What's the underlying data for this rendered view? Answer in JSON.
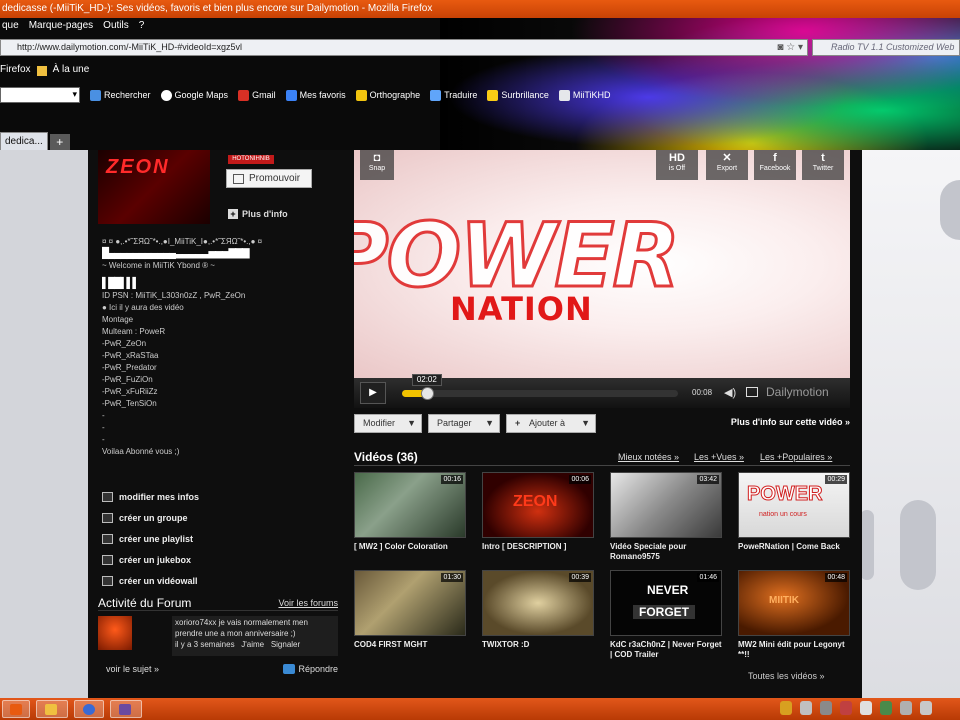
{
  "window": {
    "title": "dedicasse (-MiiTiK_HD-): Ses vidéos, favoris et bien plus encore sur Dailymotion - Mozilla Firefox"
  },
  "menu": [
    "que",
    "Marque-pages",
    "Outils",
    "?"
  ],
  "nav": {
    "url": "http://www.dailymotion.com/-MiiTiK_HD-#videoId=xgz5vl",
    "search_placeholder": "Radio TV 1.1 Customized Web"
  },
  "bookmarks_row": [
    "Firefox",
    "À la une"
  ],
  "toolbar": {
    "search_label": "Rechercher",
    "items": [
      {
        "label": "Google Maps",
        "color": "#ffffff"
      },
      {
        "label": "Gmail",
        "color": "#d93025"
      },
      {
        "label": "Mes favoris",
        "color": "#3b82f6"
      },
      {
        "label": "Orthographe",
        "color": "#f1c40f"
      },
      {
        "label": "Traduire",
        "color": "#60a5fa"
      },
      {
        "label": "Surbrillance",
        "color": "#facc15"
      },
      {
        "label": "MiiTiKHD",
        "color": "#e5e7eb"
      }
    ]
  },
  "tabs": {
    "active": "dedica...",
    "new_tab": "+"
  },
  "profile": {
    "badge": "HOTONIHNIB",
    "promote_label": "Promouvoir",
    "more_info_label": "Plus d'info",
    "bio_lines": [
      "¤ ¤ ●,.•*˜ΣЯΩ˜*•.,●I_MiiTiK_I●,.•*˜ΣЯΩ˜*•.,● ¤",
      "█▄▄▄▄▄▄▄▄▄▄▄▃▃▃▃▃▅▅▅▇▇▇",
      "~ Welcome in MiiTiK Ybond ® ~",
      "",
      "▌██▌▌▌",
      "ID PSN : MiiTiK_L303n0zZ , PwR_ZeOn",
      "● Ici il y aura des vidéo",
      "Montage",
      "Multeam : PoweR",
      "-PwR_ZeOn",
      "-PwR_xRaSTaa",
      "-PwR_Predator",
      "-PwR_FuZiOn",
      "-PwR_xFuRiiZz",
      "-PwR_TenSiOn",
      "-",
      "-",
      "-",
      "Voilaa Abonné vous ;)"
    ],
    "actions": [
      {
        "label": "modifier mes infos",
        "icon": "pencil-icon"
      },
      {
        "label": "créer un groupe",
        "icon": "group-icon"
      },
      {
        "label": "créer une playlist",
        "icon": "playlist-icon"
      },
      {
        "label": "créer un jukebox",
        "icon": "jukebox-icon"
      },
      {
        "label": "créer un vidéowall",
        "icon": "videowall-icon"
      }
    ]
  },
  "forum": {
    "title": "Activité du Forum",
    "see_all": "Voir les forums",
    "post_text": "xorioro74xx je vais normalement men prendre une a mon anniversaire ;)",
    "post_meta": "il y a 3 semaines",
    "like_label": "J'aime",
    "report_label": "Signaler",
    "view_subject": "voir le sujet »",
    "reply_label": "Répondre"
  },
  "player": {
    "title_word": "POWER",
    "subtitle_word": "NATION",
    "snap_label": "Snap",
    "tools": [
      {
        "glyph": "HD",
        "label": "is Off"
      },
      {
        "glyph": "✕",
        "label": "Export"
      },
      {
        "glyph": "f",
        "label": "Facebook"
      },
      {
        "glyph": "t",
        "label": "Twitter"
      }
    ],
    "current_time": "02:02",
    "duration": "00:08",
    "progress": 0.09,
    "brand": "Dailymotion"
  },
  "video_actions": {
    "modify": "Modifier",
    "share": "Partager",
    "add": "Ajouter à",
    "more_info": "Plus d'info sur cette vidéo »"
  },
  "videos": {
    "title": "Vidéos (36)",
    "filters": [
      "Mieux notées »",
      "Les +Vues »",
      "Les +Populaires »"
    ],
    "items": [
      {
        "title": "[ MW2 ] Color Coloration",
        "duration": "00:16"
      },
      {
        "title": "Intro [ DESCRIPTION ]",
        "duration": "00:06"
      },
      {
        "title": "Vidéo Speciale pour Romano9575",
        "duration": "03:42"
      },
      {
        "title": "PoweRNation | Come Back",
        "duration": "00:29"
      },
      {
        "title": "COD4 FIRST MGHT",
        "duration": "01:30"
      },
      {
        "title": "TWIXTOR :D",
        "duration": "00:39"
      },
      {
        "title": "KdC r3aCh0nZ | Never Forget | COD Trailer",
        "duration": "01:46"
      },
      {
        "title": "MW2 Mini édit pour Legonyt **!!",
        "duration": "00:48"
      }
    ],
    "see_all": "Toutes les vidéos »"
  },
  "thumb_text": {
    "zeon": "ZEON",
    "power": "POWER",
    "nation": "nation un cours",
    "never": "NEVER",
    "forget": "FORGET",
    "miitik": "MIITIK"
  }
}
